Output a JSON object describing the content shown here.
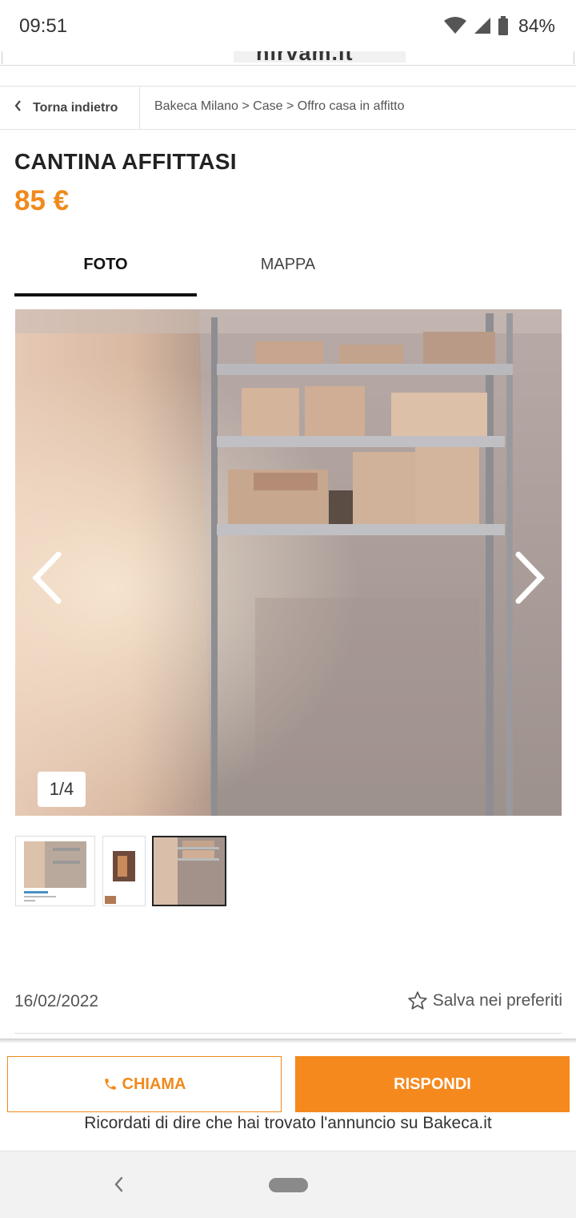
{
  "status_bar": {
    "time": "09:51",
    "battery": "84%"
  },
  "banner": {
    "logo_text": "nirvam.it"
  },
  "nav": {
    "back_label": "Torna indietro",
    "breadcrumb": "Bakeca Milano > Case > Offro casa in affitto"
  },
  "ad": {
    "title": "CANTINA AFFITTASI",
    "price": "85 €"
  },
  "tabs": [
    {
      "label": "FOTO",
      "active": true
    },
    {
      "label": "MAPPA",
      "active": false
    }
  ],
  "gallery": {
    "counter": "1/4"
  },
  "meta": {
    "date": "16/02/2022",
    "save_label": "Salva nei preferiti"
  },
  "actions": {
    "call_label": "CHIAMA",
    "reply_label": "RISPONDI",
    "reminder": "Ricordati di dire che hai trovato l'annuncio su Bakeca.it"
  },
  "colors": {
    "accent": "#f5891e",
    "text": "#222222"
  },
  "icons": [
    "wifi-icon",
    "signal-icon",
    "battery-icon",
    "chevron-left-icon",
    "chevron-right-icon",
    "star-outline-icon",
    "phone-icon",
    "system-back-icon",
    "system-home-pill"
  ]
}
